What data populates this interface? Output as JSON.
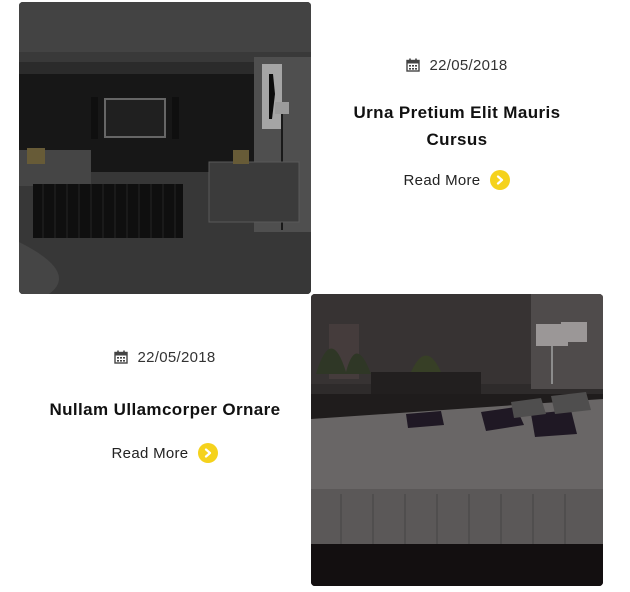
{
  "posts": [
    {
      "image": "living-room-photo",
      "date": "22/05/2018",
      "title": "Urna Pretium Elit Mauris Cursus",
      "read_more": "Read More"
    },
    {
      "image": "bedroom-photo",
      "date": "22/05/2018",
      "title": "Nullam Ullamcorper Ornare",
      "read_more": "Read More"
    }
  ],
  "colors": {
    "accent": "#f5d21c",
    "overlay": "#000000"
  },
  "icons": {
    "date": "calendar-icon",
    "read_more": "chevron-right-icon"
  }
}
